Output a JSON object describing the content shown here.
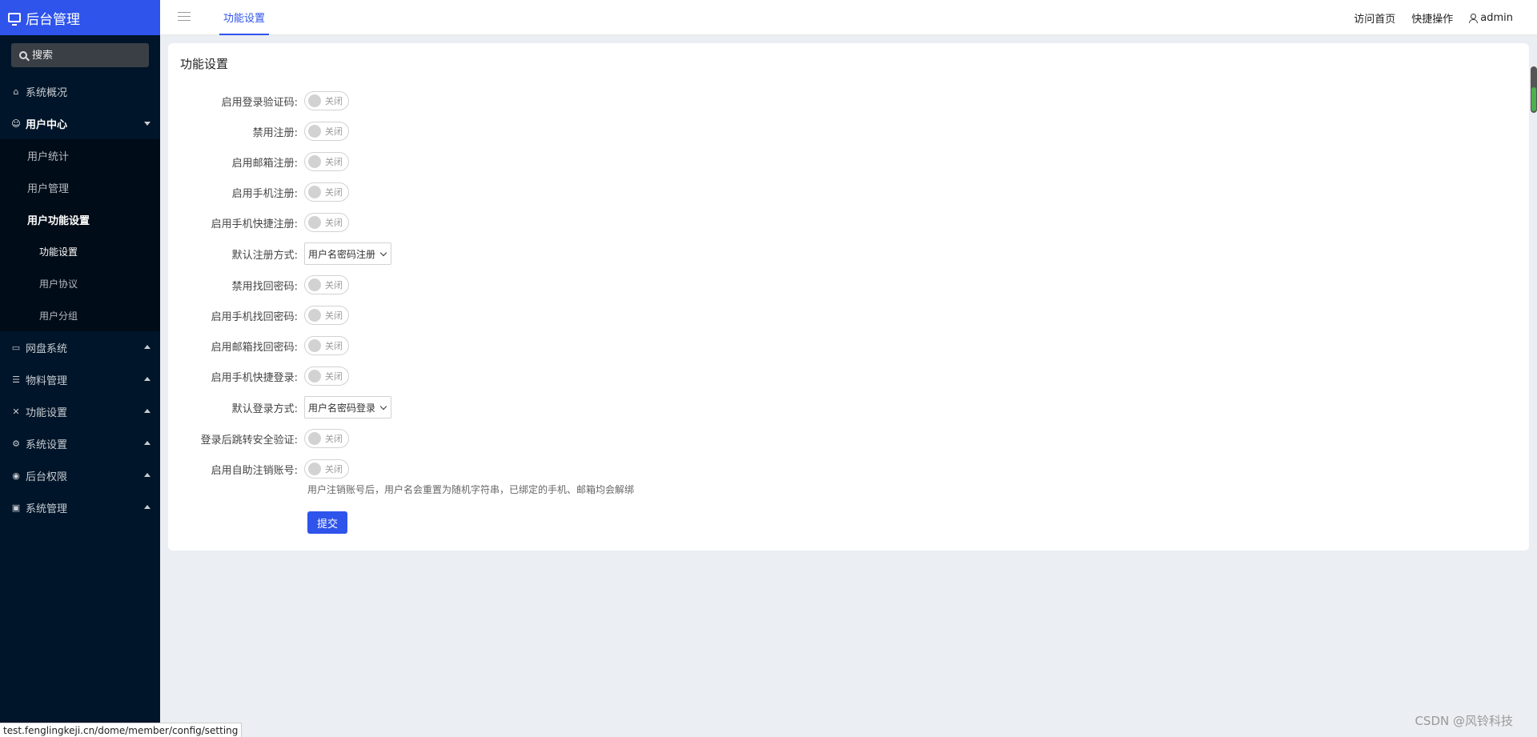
{
  "brand": {
    "title": "后台管理"
  },
  "search": {
    "placeholder": "搜索"
  },
  "sidebar": {
    "items": [
      {
        "label": "系统概况"
      },
      {
        "label": "用户中心"
      },
      {
        "label": "网盘系统"
      },
      {
        "label": "物料管理"
      },
      {
        "label": "功能设置"
      },
      {
        "label": "系统设置"
      },
      {
        "label": "后台权限"
      },
      {
        "label": "系统管理"
      }
    ],
    "user_center": {
      "sub": [
        {
          "label": "用户统计"
        },
        {
          "label": "用户管理"
        },
        {
          "label": "用户功能设置"
        }
      ],
      "func_sub": [
        {
          "label": "功能设置"
        },
        {
          "label": "用户协议"
        },
        {
          "label": "用户分组"
        }
      ]
    }
  },
  "header": {
    "active_tab": "功能设置",
    "links": {
      "home": "访问首页",
      "quick": "快捷操作",
      "user": "admin"
    }
  },
  "form": {
    "title": "功能设置",
    "off_text": "关闭",
    "rows": [
      {
        "label": "启用登录验证码:"
      },
      {
        "label": "禁用注册:"
      },
      {
        "label": "启用邮箱注册:"
      },
      {
        "label": "启用手机注册:"
      },
      {
        "label": "启用手机快捷注册:"
      },
      {
        "label": "默认注册方式:",
        "value": "用户名密码注册"
      },
      {
        "label": "禁用找回密码:"
      },
      {
        "label": "启用手机找回密码:"
      },
      {
        "label": "启用邮箱找回密码:"
      },
      {
        "label": "启用手机快捷登录:"
      },
      {
        "label": "默认登录方式:",
        "value": "用户名密码登录"
      },
      {
        "label": "登录后跳转安全验证:"
      },
      {
        "label": "启用自助注销账号:"
      }
    ],
    "hint": "用户注销账号后，用户名会重置为随机字符串，已绑定的手机、邮箱均会解绑",
    "submit": "提交"
  },
  "status_url": "test.fenglingkeji.cn/dome/member/config/setting",
  "watermark": "CSDN @风铃科技"
}
